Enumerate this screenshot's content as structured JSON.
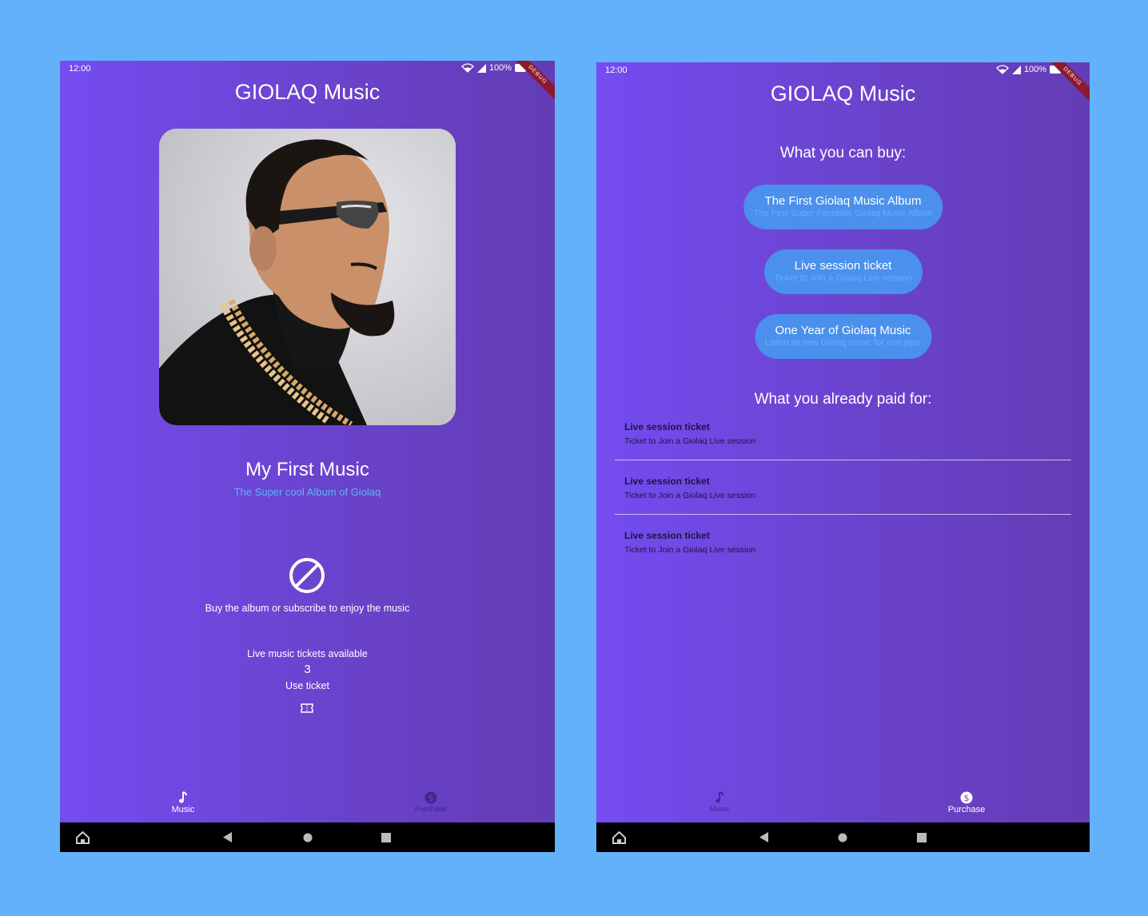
{
  "colors": {
    "background": "#62b1fa",
    "gradient_start": "#744cf1",
    "gradient_end": "#643cb5",
    "accent_blue": "#4a90ec",
    "subtitle_blue": "#5fb3f6",
    "debug_ribbon": "#8b1a2e"
  },
  "status_bar": {
    "time": "12:00",
    "battery": "100%",
    "debug_label": "DEBUG"
  },
  "app": {
    "title": "GIOLAQ Music"
  },
  "music_screen": {
    "album_title": "My First Music",
    "album_subtitle": "The Super cool Album of Giolaq",
    "blocked_icon": "block-icon",
    "blocked_message": "Buy the album or subscribe to enjoy the music",
    "tickets_label": "Live music tickets available",
    "tickets_count": "3",
    "use_ticket_label": "Use ticket",
    "ticket_icon": "ticket-icon"
  },
  "purchase_screen": {
    "buy_heading": "What you can buy:",
    "products": [
      {
        "title": "The First Giolaq Music Album",
        "description": "The First Super Fantastic Giolaq Music Album"
      },
      {
        "title": "Live session ticket",
        "description": "Ticket to Join a Giolaq Live session"
      },
      {
        "title": "One Year of Giolaq Music",
        "description": "Listen all new Giolaq music for one year"
      }
    ],
    "paid_heading": "What you already paid for:",
    "paid_items": [
      {
        "title": "Live session ticket",
        "description": "Ticket to Join a Giolaq Live session"
      },
      {
        "title": "Live session ticket",
        "description": "Ticket to Join a Giolaq Live session"
      },
      {
        "title": "Live session ticket",
        "description": "Ticket to Join a Giolaq Live session"
      }
    ]
  },
  "bottom_nav": {
    "items": [
      {
        "label": "Music",
        "icon": "music-note-icon"
      },
      {
        "label": "Purchase",
        "icon": "dollar-icon"
      }
    ],
    "music_screen_active": "Music",
    "purchase_screen_active": "Purchase"
  },
  "system_nav": {
    "icons": [
      "home-assistant-icon",
      "back-icon",
      "home-icon",
      "recents-icon"
    ]
  }
}
